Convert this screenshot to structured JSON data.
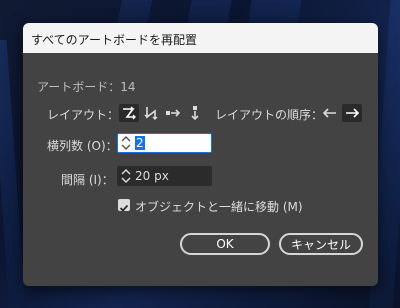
{
  "dialog": {
    "title": "すべてのアートボードを再配置",
    "artboard_count_label": "アートボード：14",
    "layout_label": "レイアウト：",
    "layout_options": [
      {
        "name": "grid-by-row",
        "selected": true
      },
      {
        "name": "grid-by-column",
        "selected": false
      },
      {
        "name": "arrange-by-row",
        "selected": false
      },
      {
        "name": "arrange-by-column",
        "selected": false
      }
    ],
    "layout_order_label": "レイアウトの順序：",
    "layout_order_options": [
      {
        "name": "left-to-right",
        "selected": false
      },
      {
        "name": "right-to-left",
        "selected": true
      }
    ],
    "columns_label": "横列数 (O)：",
    "columns_value": "2",
    "spacing_label": "間隔 (I)：",
    "spacing_value": "20 px",
    "move_artwork_label": "オブジェクトと一緒に移動 (M)",
    "move_artwork_checked": true,
    "ok_label": "OK",
    "cancel_label": "キャンセル"
  },
  "colors": {
    "dialog_bg": "#434343",
    "titlebar_bg": "#f4f4f4",
    "accent": "#1473e6"
  }
}
